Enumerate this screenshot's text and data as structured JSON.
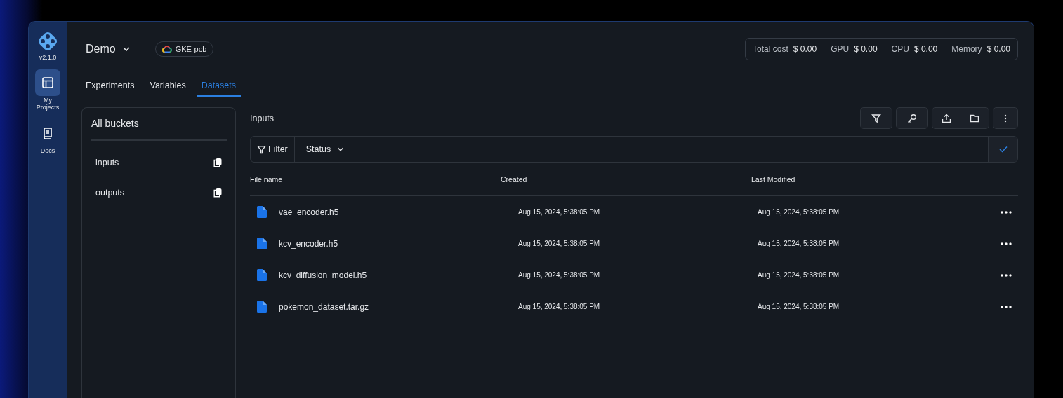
{
  "app": {
    "version": "v2.1.0"
  },
  "nav": [
    {
      "label": "My Projects",
      "selected": true,
      "kind": "projects"
    },
    {
      "label": "Docs",
      "selected": false,
      "kind": "docs"
    }
  ],
  "project": {
    "name": "Demo",
    "cluster": "GKE-pcb"
  },
  "costs": [
    {
      "label": "Total cost",
      "value": "$ 0.00"
    },
    {
      "label": "GPU",
      "value": "$ 0.00"
    },
    {
      "label": "CPU",
      "value": "$ 0.00"
    },
    {
      "label": "Memory",
      "value": "$ 0.00"
    }
  ],
  "tabs": [
    {
      "label": "Experiments",
      "selected": false
    },
    {
      "label": "Variables",
      "selected": false
    },
    {
      "label": "Datasets",
      "selected": true
    }
  ],
  "buckets": {
    "title": "All buckets",
    "items": [
      {
        "name": "inputs"
      },
      {
        "name": "outputs"
      }
    ]
  },
  "files": {
    "title": "Inputs",
    "filter_label": "Filter",
    "status_label": "Status",
    "columns": [
      "File name",
      "Created",
      "Last Modified"
    ],
    "rows": [
      {
        "name": "vae_encoder.h5",
        "created": "Aug 15, 2024, 5:38:05 PM",
        "modified": "Aug 15, 2024, 5:38:05 PM"
      },
      {
        "name": "kcv_encoder.h5",
        "created": "Aug 15, 2024, 5:38:05 PM",
        "modified": "Aug 15, 2024, 5:38:05 PM"
      },
      {
        "name": "kcv_diffusion_model.h5",
        "created": "Aug 15, 2024, 5:38:05 PM",
        "modified": "Aug 15, 2024, 5:38:05 PM"
      },
      {
        "name": "pokemon_dataset.tar.gz",
        "created": "Aug 15, 2024, 5:38:05 PM",
        "modified": "Aug 15, 2024, 5:38:05 PM"
      }
    ]
  }
}
